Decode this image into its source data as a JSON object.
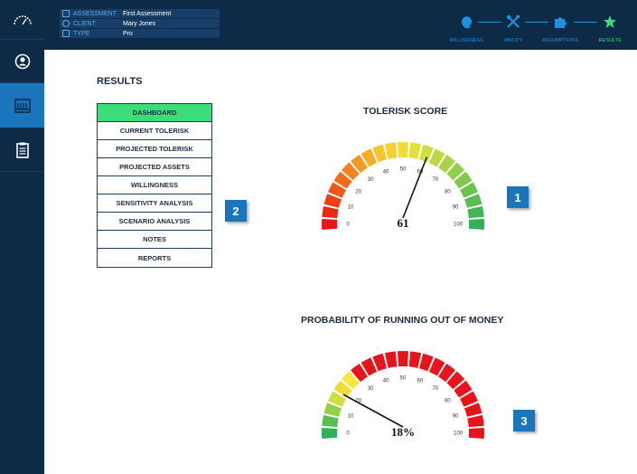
{
  "topbar": {
    "rows": [
      {
        "key": "ASSESSMENT",
        "value": "First Assessment",
        "icon": "list-icon"
      },
      {
        "key": "CLIENT",
        "value": "Mary Jones",
        "icon": "user-icon"
      },
      {
        "key": "TYPE",
        "value": "Pro",
        "icon": "card-icon"
      }
    ],
    "steps": [
      {
        "label": "WILLINGNESS",
        "icon": "head-icon",
        "done": false
      },
      {
        "label": "ABILITY",
        "icon": "tools-icon",
        "done": false
      },
      {
        "label": "ASSUMPTIONS",
        "icon": "puzzle-icon",
        "done": false
      },
      {
        "label": "RESULTS",
        "icon": "star-icon",
        "done": true
      }
    ]
  },
  "sidebar": {
    "items": [
      {
        "icon": "speedometer-icon",
        "active": false
      },
      {
        "icon": "user-circle-icon",
        "active": false
      },
      {
        "icon": "calculator-icon",
        "active": true
      },
      {
        "icon": "clipboard-icon",
        "active": false
      }
    ]
  },
  "main": {
    "title": "RESULTS",
    "menu": [
      {
        "label": "DASHBOARD",
        "active": true
      },
      {
        "label": "CURRENT TOLERISK",
        "active": false
      },
      {
        "label": "PROJECTED TOLERISK",
        "active": false
      },
      {
        "label": "PROJECTED ASSETS",
        "active": false
      },
      {
        "label": "WILLINGNESS",
        "active": false
      },
      {
        "label": "SENSITIVITY ANALYSIS",
        "active": false
      },
      {
        "label": "SCENARIO ANALYSIS",
        "active": false
      },
      {
        "label": "NOTES",
        "active": false
      },
      {
        "label": "REPORTS",
        "active": false
      }
    ],
    "callouts": [
      "1",
      "2",
      "3"
    ]
  },
  "gauges": [
    {
      "title": "TOLERISK SCORE",
      "value": 61,
      "display": "61",
      "min": 0,
      "max": 100,
      "ticks": [
        "0",
        "10",
        "20",
        "30",
        "40",
        "50",
        "60",
        "70",
        "80",
        "90",
        "100"
      ],
      "segment_colors": [
        "#e8141b",
        "#ea2a16",
        "#ed4016",
        "#ef5618",
        "#f26c1c",
        "#f4821f",
        "#f69823",
        "#f8ae27",
        "#f9c42b",
        "#f7d12f",
        "#f1dc35",
        "#e3e03c",
        "#d0de40",
        "#bcd944",
        "#a8d447",
        "#94cf4a",
        "#80c94c",
        "#6cc34f",
        "#58bd52",
        "#44b755",
        "#2eb157"
      ]
    },
    {
      "title": "PROBABILITY OF RUNNING OUT OF MONEY",
      "value": 18,
      "display": "18%",
      "min": 0,
      "max": 100,
      "ticks": [
        "0",
        "10",
        "20",
        "30",
        "40",
        "50",
        "60",
        "70",
        "80",
        "90",
        "100"
      ],
      "segment_colors": [
        "#2eb157",
        "#58bd52",
        "#94cf4a",
        "#d0de40",
        "#f1dc35",
        "#f7e63b",
        "#e8141b",
        "#e8141b",
        "#e8141b",
        "#e8141b",
        "#e8141b",
        "#e8141b",
        "#e8141b",
        "#e8141b",
        "#e8141b",
        "#e8141b",
        "#e8141b",
        "#e8141b",
        "#e8141b",
        "#e8141b",
        "#e8141b"
      ]
    }
  ]
}
